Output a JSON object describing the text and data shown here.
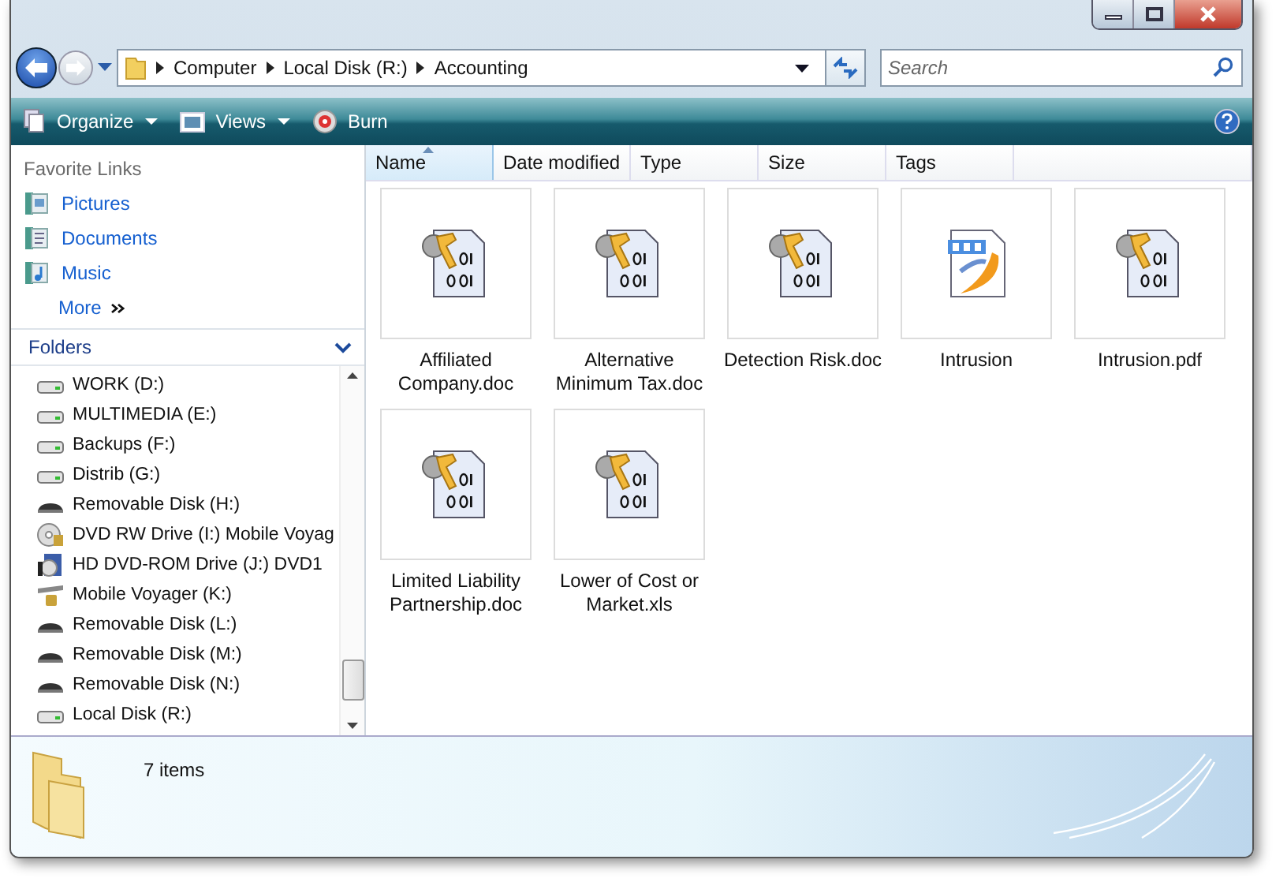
{
  "address_bar": {
    "segments": [
      "Computer",
      "Local Disk (R:)",
      "Accounting"
    ]
  },
  "search": {
    "placeholder": "Search"
  },
  "toolbar": {
    "items": [
      {
        "label": "Organize",
        "kind": "organize"
      },
      {
        "label": "Views",
        "kind": "views"
      },
      {
        "label": "Burn",
        "kind": "burn"
      }
    ]
  },
  "favorite_links": {
    "title": "Favorite Links",
    "items": [
      {
        "label": "Pictures",
        "kind": "pictures"
      },
      {
        "label": "Documents",
        "kind": "documents"
      },
      {
        "label": "Music",
        "kind": "music"
      }
    ],
    "more": "More"
  },
  "folders": {
    "title": "Folders",
    "items": [
      {
        "label": "WORK (D:)",
        "kind": "disk"
      },
      {
        "label": "MULTIMEDIA (E:)",
        "kind": "disk"
      },
      {
        "label": "Backups (F:)",
        "kind": "disk"
      },
      {
        "label": "Distrib (G:)",
        "kind": "disk"
      },
      {
        "label": "Removable Disk (H:)",
        "kind": "removable"
      },
      {
        "label": "DVD RW Drive (I:) Mobile Voyag",
        "kind": "dvd"
      },
      {
        "label": "HD DVD-ROM Drive (J:) DVD1",
        "kind": "hddvd"
      },
      {
        "label": "Mobile Voyager (K:)",
        "kind": "mobile"
      },
      {
        "label": "Removable Disk (L:)",
        "kind": "removable"
      },
      {
        "label": "Removable Disk (M:)",
        "kind": "removable"
      },
      {
        "label": "Removable Disk (N:)",
        "kind": "removable"
      },
      {
        "label": "Local Disk (R:)",
        "kind": "disk"
      }
    ]
  },
  "columns": [
    {
      "label": "Name",
      "selected": true
    },
    {
      "label": "Date modified",
      "selected": false
    },
    {
      "label": "Type",
      "selected": false
    },
    {
      "label": "Size",
      "selected": false
    },
    {
      "label": "Tags",
      "selected": false
    }
  ],
  "files": [
    {
      "name": "Affiliated Company.doc",
      "kind": "encrypted"
    },
    {
      "name": "Alternative Minimum Tax.doc",
      "kind": "encrypted"
    },
    {
      "name": "Detection Risk.doc",
      "kind": "encrypted"
    },
    {
      "name": "Intrusion",
      "kind": "pdf"
    },
    {
      "name": "Intrusion.pdf",
      "kind": "encrypted"
    },
    {
      "name": "Limited Liability Partnership.doc",
      "kind": "encrypted"
    },
    {
      "name": "Lower of Cost or Market.xls",
      "kind": "encrypted"
    }
  ],
  "status_bar": {
    "count": "7 items"
  }
}
